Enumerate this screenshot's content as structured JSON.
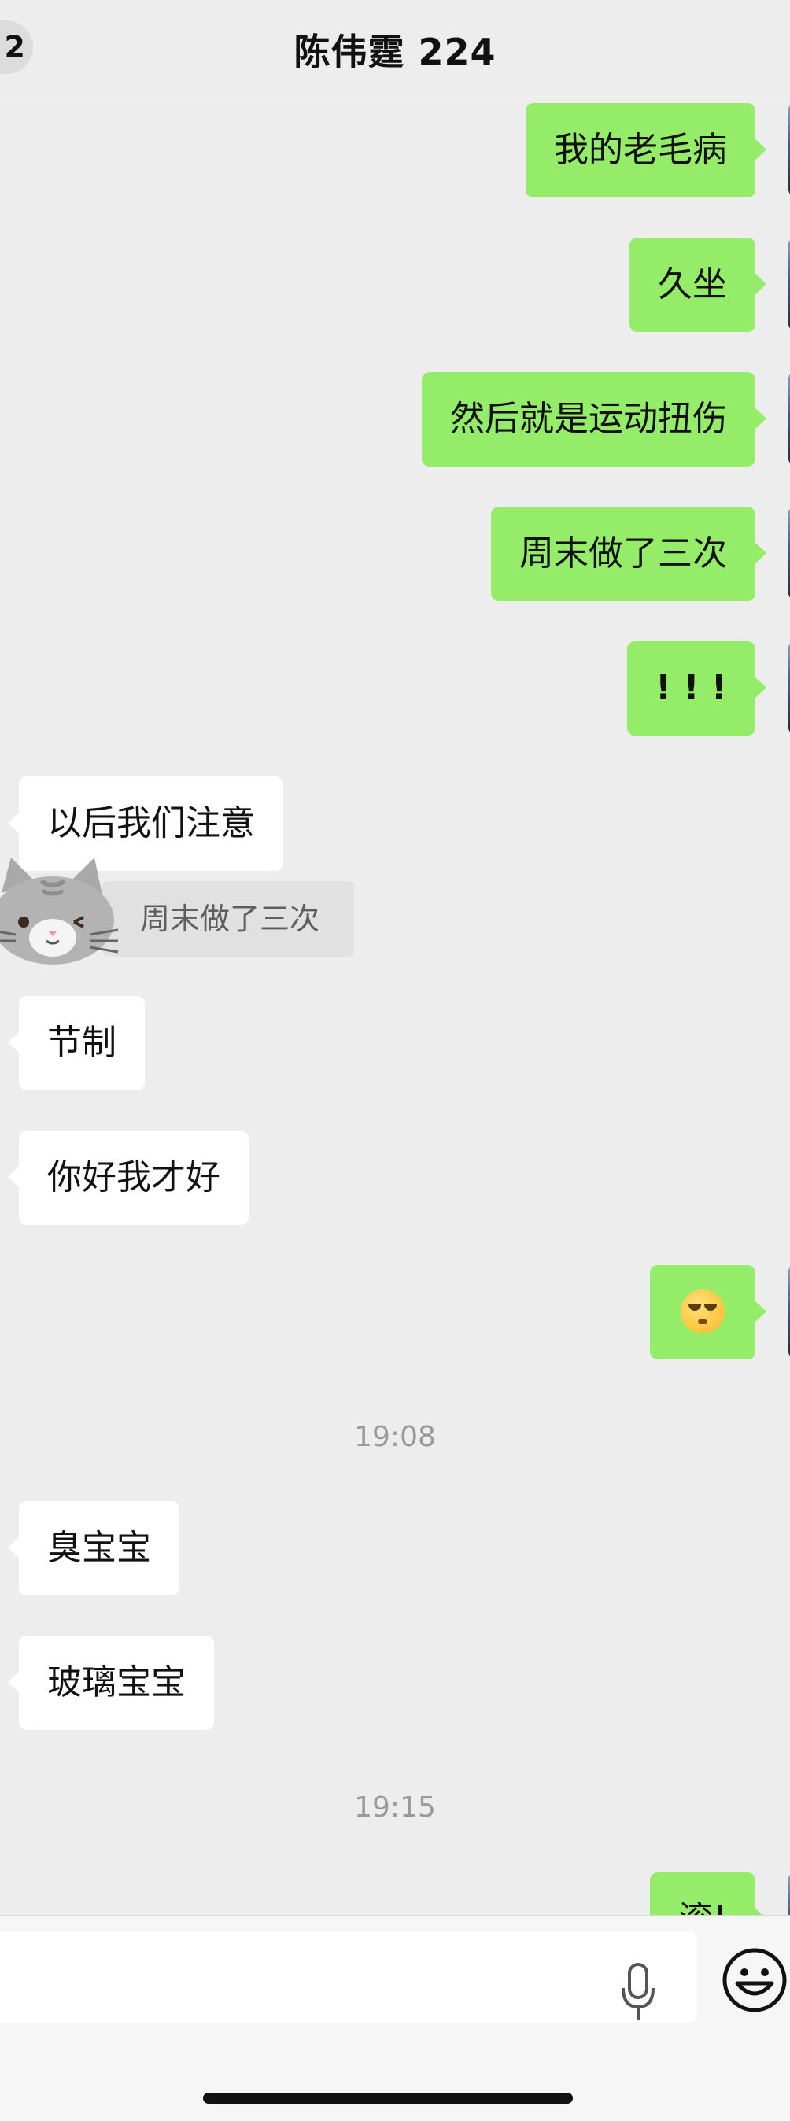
{
  "header": {
    "unread_count": "2",
    "title": "陈伟霆 224"
  },
  "messages": [
    {
      "side": "out",
      "text": "我的老毛病"
    },
    {
      "side": "out",
      "text": "久坐"
    },
    {
      "side": "out",
      "text": "然后就是运动扭伤"
    },
    {
      "side": "out",
      "text": "周末做了三次"
    },
    {
      "side": "out",
      "text": "! ! !"
    },
    {
      "side": "in",
      "text": "以后我们注意"
    },
    {
      "side": "in",
      "text": "节制"
    },
    {
      "side": "in",
      "text": "你好我才好"
    },
    {
      "side": "out",
      "emoji": "rolling-eyes-emoji"
    },
    {
      "side": "in",
      "text": "臭宝宝"
    },
    {
      "side": "in",
      "text": "玻璃宝宝"
    },
    {
      "side": "out",
      "text": "滚!"
    }
  ],
  "quote": {
    "text": "周末做了三次"
  },
  "timestamps": [
    "19:08",
    "19:15"
  ],
  "input_bar": {
    "icons": [
      "mic-icon",
      "emoji-icon"
    ]
  },
  "colors": {
    "outgoing_bubble": "#95ec69",
    "incoming_bubble": "#ffffff",
    "background": "#ededed"
  }
}
